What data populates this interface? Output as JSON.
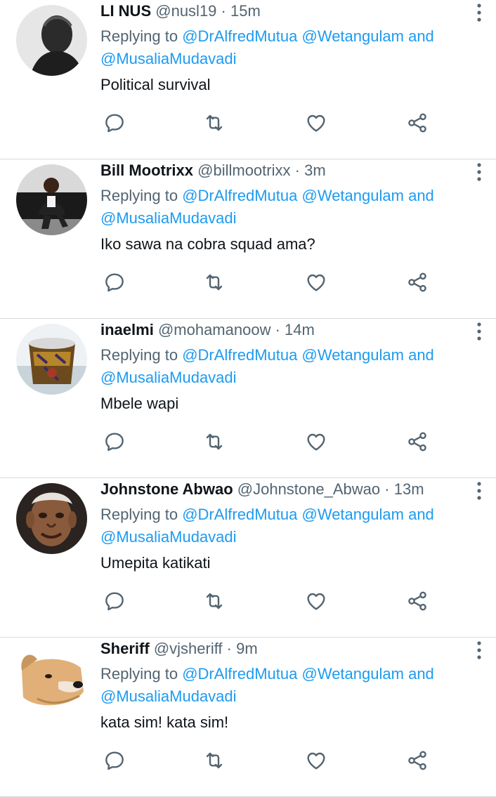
{
  "common": {
    "replying_prefix": "Replying to",
    "mention_1": "@DrAlfredMutua",
    "mention_2": "@Wetangulam",
    "and_text": "and",
    "mention_3": "@MusaliaMudavadi",
    "separator": "·"
  },
  "icons": {
    "reply": "reply-icon",
    "retweet": "retweet-icon",
    "like": "heart-icon",
    "share": "share-icon",
    "more": "more-vertical-icon"
  },
  "colors": {
    "link": "#1d9bf0",
    "secondary_text": "#536471",
    "primary_text": "#0f1419",
    "divider": "#d5dbe0"
  },
  "tweets": [
    {
      "name": "LI NUS",
      "handle": "@nusl19",
      "time": "15m",
      "text": "Political survival"
    },
    {
      "name": "Bill Mootrixx",
      "handle": "@billmootrixx",
      "time": "3m",
      "text": "Iko sawa na cobra squad ama?"
    },
    {
      "name": "inaelmi",
      "handle": "@mohamanoow",
      "time": "14m",
      "text": "Mbele wapi"
    },
    {
      "name": "Johnstone Abwao",
      "handle": "@Johnstone_Abwao",
      "time": "13m",
      "text": "Umepita katikati"
    },
    {
      "name": "Sheriff",
      "handle": "@vjsheriff",
      "time": "9m",
      "text": "kata sim! kata sim!"
    }
  ]
}
